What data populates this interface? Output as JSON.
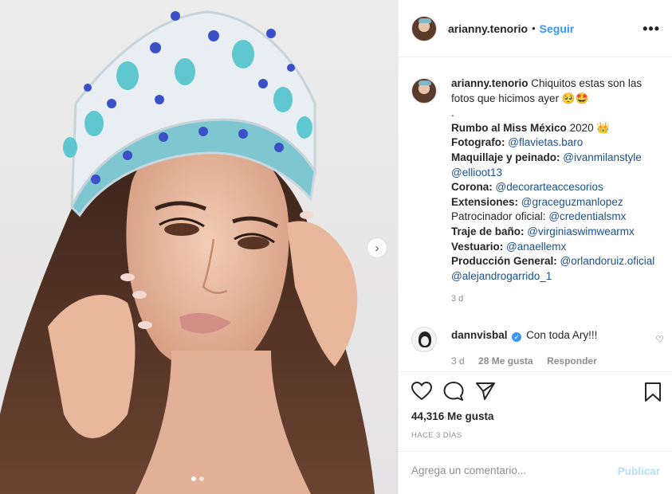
{
  "header": {
    "username": "arianny.tenorio",
    "separator": "•",
    "follow_label": "Seguir",
    "more_label": "•••"
  },
  "caption": {
    "username": "arianny.tenorio",
    "text": "Chiquitos estas son las fotos que hicimos ayer 🥺🤩",
    "dot_line": ".",
    "lines": [
      {
        "label": "Rumbo al Miss México",
        "value": "2020 👑"
      },
      {
        "label": "Fotografo:",
        "value": "@flavietas.baro"
      },
      {
        "label": "Maquillaje y peinado:",
        "value": "@ivanmilanstyle"
      },
      {
        "label": "",
        "value": "@ellioot13"
      },
      {
        "label": "Corona:",
        "value": "@decorarteaccesorios"
      },
      {
        "label": "Extensiones:",
        "value": "@graceguzmanlopez"
      },
      {
        "label": "Patrocinador oficial:",
        "value": "@credentialsmx"
      },
      {
        "label": "Traje de baño:",
        "value": "@virginiaswimwearmx"
      },
      {
        "label": "Vestuario:",
        "value": "@anaellemx"
      },
      {
        "label": "Producción General:",
        "value": "@orlandoruiz.oficial"
      },
      {
        "label": "",
        "value": "@alejandrogarrido_1"
      }
    ],
    "time": "3 d"
  },
  "comment": {
    "username": "dannvisbal",
    "verified_glyph": "✓",
    "text": "Con toda Ary!!!",
    "time": "3 d",
    "likes": "28 Me gusta",
    "reply_label": "Responder",
    "heart_glyph": "♡"
  },
  "stats": {
    "likes": "44,316 Me gusta",
    "ago": "HACE 3 DÍAS"
  },
  "composer": {
    "placeholder": "Agrega un comentario...",
    "publish_label": "Publicar"
  },
  "carousel": {
    "next_glyph": "›",
    "slide_count": 2,
    "active_slide": 1
  },
  "colors": {
    "link": "#1a4f8f",
    "follow": "#3897f0",
    "publish_disabled": "#b2dffc"
  }
}
